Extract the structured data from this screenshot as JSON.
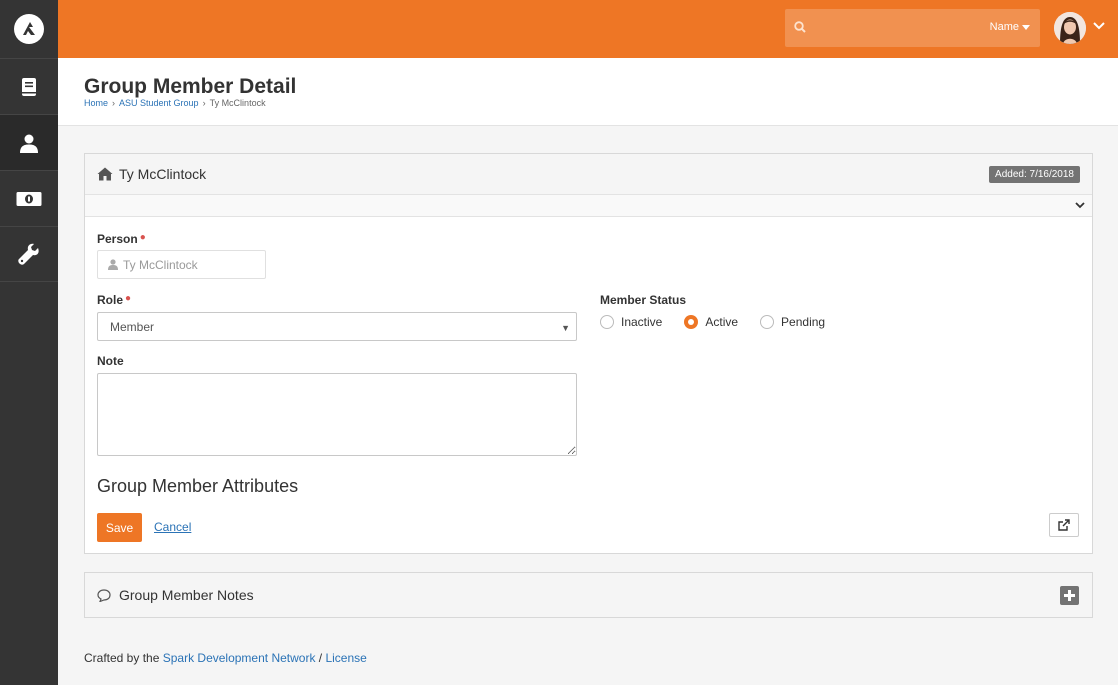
{
  "app": {
    "logo_icon": "rock-logo-icon",
    "accent_color": "#ee7625",
    "sidebar": {
      "items": [
        {
          "name": "book-icon",
          "active": false
        },
        {
          "name": "person-icon",
          "active": true
        },
        {
          "name": "money-icon",
          "active": false
        },
        {
          "name": "wrench-icon",
          "active": false
        }
      ]
    },
    "topbar": {
      "search_placeholder": "",
      "search_filter_label": "Name",
      "search_icon": "search-icon",
      "avatar_chevron": "chevron-down-icon"
    }
  },
  "page": {
    "title": "Group Member Detail",
    "breadcrumb": [
      {
        "label": "Home"
      },
      {
        "label": "ASU Student Group"
      },
      {
        "label": "Ty McClintock"
      }
    ]
  },
  "panel": {
    "title": "Ty McClintock",
    "title_icon": "home-icon",
    "badge": "Added: 7/16/2018",
    "person_label": "Person",
    "person_value": "Ty McClintock",
    "role_label": "Role",
    "role_value": "Member",
    "member_status_label": "Member Status",
    "status_options": [
      {
        "label": "Inactive",
        "checked": false
      },
      {
        "label": "Active",
        "checked": true
      },
      {
        "label": "Pending",
        "checked": false
      }
    ],
    "note_label": "Note",
    "note_value": "",
    "attributes_title": "Group Member Attributes",
    "save_label": "Save",
    "cancel_label": "Cancel"
  },
  "notes_panel": {
    "title": "Group Member Notes"
  },
  "footer": {
    "prefix": "Crafted by the ",
    "link1": "Spark Development Network",
    "sep": " / ",
    "link2": "License"
  }
}
